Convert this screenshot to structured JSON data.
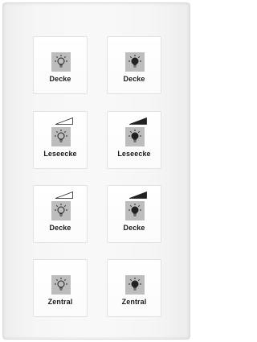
{
  "buttons": [
    {
      "label": "Decke",
      "icon": "bulb-off-icon"
    },
    {
      "label": "Decke",
      "icon": "bulb-on-icon"
    },
    {
      "label": "Leseecke",
      "icon": "dim-down-bulb-icon"
    },
    {
      "label": "Leseecke",
      "icon": "dim-up-bulb-icon"
    },
    {
      "label": "Decke",
      "icon": "dim-down-bulb-icon"
    },
    {
      "label": "Decke",
      "icon": "dim-up-bulb-icon"
    },
    {
      "label": "Zentral",
      "icon": "bulb-off-icon"
    },
    {
      "label": "Zentral",
      "icon": "bulb-on-icon"
    }
  ],
  "colors": {
    "icon_background": "#bdbdbd",
    "label_text": "#1a1a1a",
    "bulb_filled": "#222222"
  }
}
